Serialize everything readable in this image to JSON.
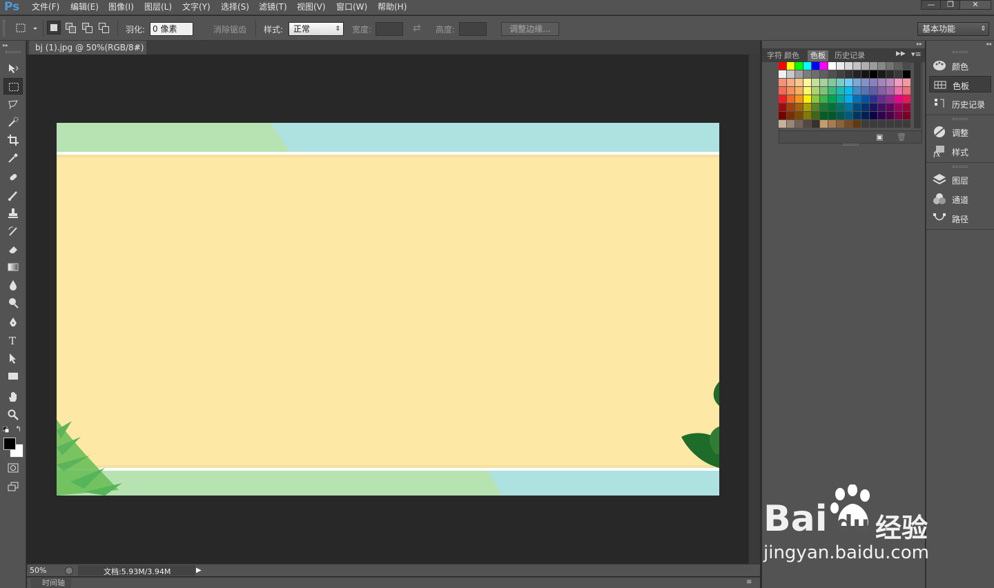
{
  "app": {
    "logo": "Ps"
  },
  "menu": [
    "文件(F)",
    "编辑(E)",
    "图像(I)",
    "图层(L)",
    "文字(Y)",
    "选择(S)",
    "滤镜(T)",
    "视图(V)",
    "窗口(W)",
    "帮助(H)"
  ],
  "window_controls": {
    "minimize": "—",
    "restore": "❐",
    "close": "✕"
  },
  "options": {
    "feather_label": "羽化:",
    "feather_value": "0 像素",
    "antialias_label": "消除锯齿",
    "style_label": "样式:",
    "style_value": "正常",
    "width_label": "宽度:",
    "height_label": "高度:",
    "refine_edge": "调整边缘...",
    "workspace": "基本功能"
  },
  "document": {
    "tab_title": "bj (1).jpg @ 50%(RGB/8#)",
    "close": "×"
  },
  "status": {
    "zoom": "50%",
    "doc_size": "文档:5.93M/3.94M",
    "timeline": "时间轴"
  },
  "panel_tabs": {
    "char": "字符",
    "color": "颜色",
    "swatches": "色板",
    "history": "历史记录"
  },
  "dock": {
    "color": "颜色",
    "swatches": "色板",
    "history": "历史记录",
    "adjustments": "调整",
    "styles": "样式",
    "layers": "图层",
    "channels": "通道",
    "paths": "路径"
  },
  "watermark": {
    "brand": "Bai",
    "brand2": "du",
    "tagline": "经验",
    "url": "jingyan.baidu.com"
  },
  "colors": {
    "ui_bg": "#535353",
    "canvas_bg": "#282828",
    "artwork_yellow": "#fde8a5",
    "artwork_green": "#b7e3b3",
    "artwork_cyan": "#aee2e0",
    "leaf_green": "#2e7d32"
  }
}
